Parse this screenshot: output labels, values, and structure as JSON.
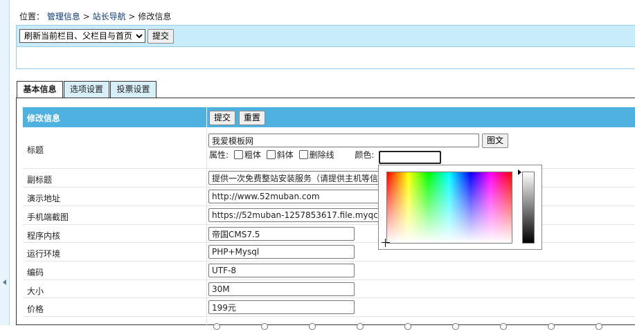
{
  "breadcrumb": {
    "prefix": "位置：",
    "items": [
      "管理信息",
      "站长导航",
      "修改信息"
    ],
    "sep": ">"
  },
  "toolbar": {
    "refresh_select": "刷新当前栏目、父栏目与首页",
    "submit_label": "提交"
  },
  "tabs": [
    {
      "label": "基本信息",
      "active": true
    },
    {
      "label": "选项设置",
      "active": false
    },
    {
      "label": "投票设置",
      "active": false
    }
  ],
  "form": {
    "header_title": "修改信息",
    "submit_label": "提交",
    "reset_label": "重置",
    "title_label": "标题",
    "title_value": "我爱模板网",
    "title_button": "图文",
    "attr_label": "属性:",
    "bold_label": "粗体",
    "italic_label": "斜体",
    "strike_label": "删除线",
    "color_label": "颜色:",
    "fields": [
      {
        "label": "副标题",
        "value": "提供一次免费整站安装服务（请提供主机等信息）"
      },
      {
        "label": "演示地址",
        "value": "http://www.52muban.com"
      },
      {
        "label": "手机端截图",
        "value": "https://52muban-1257853617.file.myqcloud.com"
      },
      {
        "label": "程序内核",
        "value": "帝国CMS7.5"
      },
      {
        "label": "运行环境",
        "value": "PHP+Mysql"
      },
      {
        "label": "编码",
        "value": "UTF-8"
      },
      {
        "label": "大小",
        "value": "30M"
      },
      {
        "label": "价格",
        "value": "199元"
      }
    ]
  },
  "colors": {
    "header_bg": "#4fb1df",
    "toolbar_bg": "#c9ecfb",
    "tab_bg": "#d8eef9",
    "link": "#0b3a75"
  }
}
